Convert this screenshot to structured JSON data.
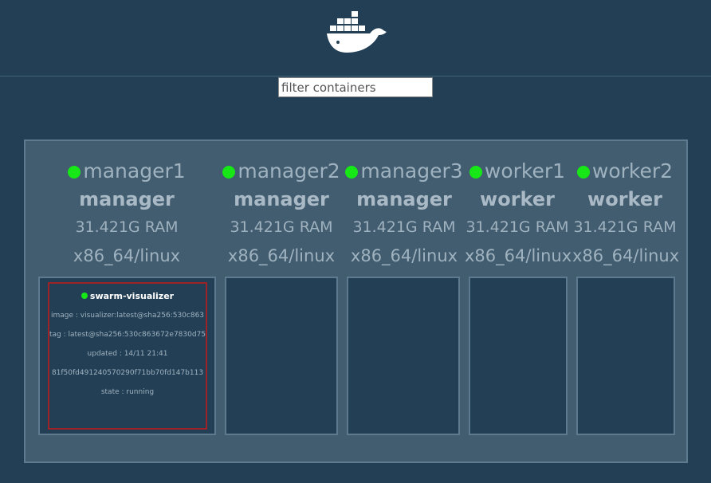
{
  "header": {
    "logo_icon": "docker-whale-icon"
  },
  "filter": {
    "placeholder": "filter containers"
  },
  "nodes": [
    {
      "name": "manager1",
      "role": "manager",
      "ram": "31.421G RAM",
      "arch": "x86_64/linux",
      "status_color": "#17e617"
    },
    {
      "name": "manager2",
      "role": "manager",
      "ram": "31.421G RAM",
      "arch": "x86_64/linux",
      "status_color": "#17e617"
    },
    {
      "name": "manager3",
      "role": "manager",
      "ram": "31.421G RAM",
      "arch": "x86_64/linux",
      "status_color": "#17e617"
    },
    {
      "name": "worker1",
      "role": "worker",
      "ram": "31.421G RAM",
      "arch": "x86_64/linux",
      "status_color": "#17e617"
    },
    {
      "name": "worker2",
      "role": "worker",
      "ram": "31.421G RAM",
      "arch": "x86_64/linux",
      "status_color": "#17e617"
    }
  ],
  "task": {
    "name": "swarm-visualizer",
    "image": "image : visualizer:latest@sha256:530c863",
    "tag": "tag : latest@sha256:530c863672e7830d75",
    "updated": "updated : 14/11 21:41",
    "id": "81f50fd491240570290f71bb70fd147b113",
    "state": "state : running"
  },
  "colors": {
    "background": "#233f55",
    "board": "#425c70",
    "running": "#17e617",
    "task_border": "#9e2326"
  }
}
